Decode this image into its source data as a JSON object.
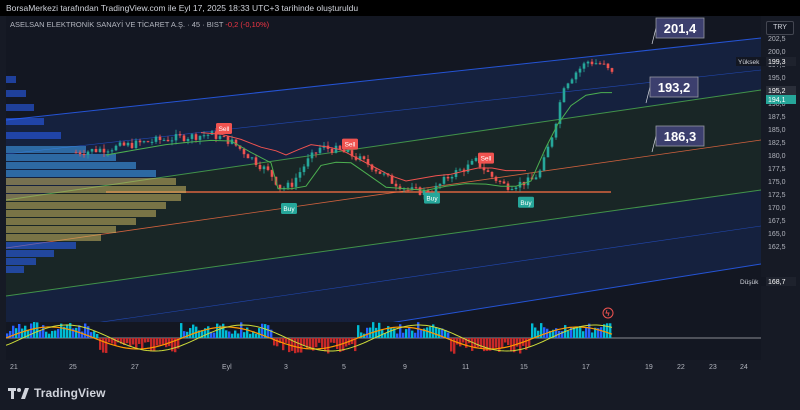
{
  "header": {
    "attribution": "BorsaMerkezi tarafından TradingView.com ile Eyl 17, 2025 18:33 UTC+3 tarihinde oluşturuldu"
  },
  "legend": {
    "symbol": "ASELSAN ELEKTRONİK SANAYİ VE TİCARET A.Ş. · 45 · BIST",
    "change": "-0,2 (-0,10%)"
  },
  "currency": "TRY",
  "price_axis": {
    "ticks": [
      "202,5",
      "200,0",
      "197,5",
      "195,0",
      "192,5",
      "190,0",
      "187,5",
      "185,0",
      "182,5",
      "180,0",
      "177,5",
      "175,0",
      "172,5",
      "170,0",
      "167,5",
      "165,0",
      "162,5"
    ],
    "high_label": "Yüksek",
    "high_value": "199,3",
    "low_label": "Düşük",
    "low_value": "168,7",
    "last_price": "195,2",
    "last_price_2": "194,1"
  },
  "channel_callouts": [
    "201,4",
    "193,2",
    "186,3"
  ],
  "signals": {
    "sell": "Sell",
    "buy": "Buy"
  },
  "time_axis": [
    "21",
    "25",
    "27",
    "Eyl",
    "3",
    "5",
    "9",
    "11",
    "15",
    "17",
    "19",
    "22",
    "23",
    "24"
  ],
  "brand": {
    "name": "TradingView"
  },
  "colors": {
    "up": "#26a69a",
    "down": "#ef5350",
    "callout": "#3c3f6e",
    "channel": "#2962ff"
  }
}
